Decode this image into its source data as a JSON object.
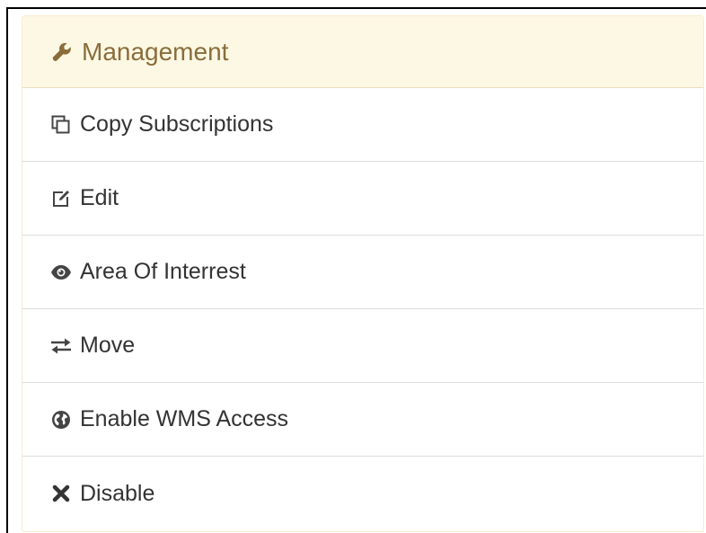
{
  "panel": {
    "heading": {
      "icon": "wrench-icon",
      "label": "Management",
      "color": "#8a6d3b",
      "background": "#fcf8e3"
    },
    "items": [
      {
        "icon": "copy-icon",
        "label": "Copy Subscriptions"
      },
      {
        "icon": "edit-icon",
        "label": "Edit"
      },
      {
        "icon": "eye-icon",
        "label": "Area Of Interrest"
      },
      {
        "icon": "transfer-icon",
        "label": "Move"
      },
      {
        "icon": "globe-icon",
        "label": "Enable WMS Access"
      },
      {
        "icon": "remove-icon",
        "label": "Disable"
      }
    ]
  }
}
